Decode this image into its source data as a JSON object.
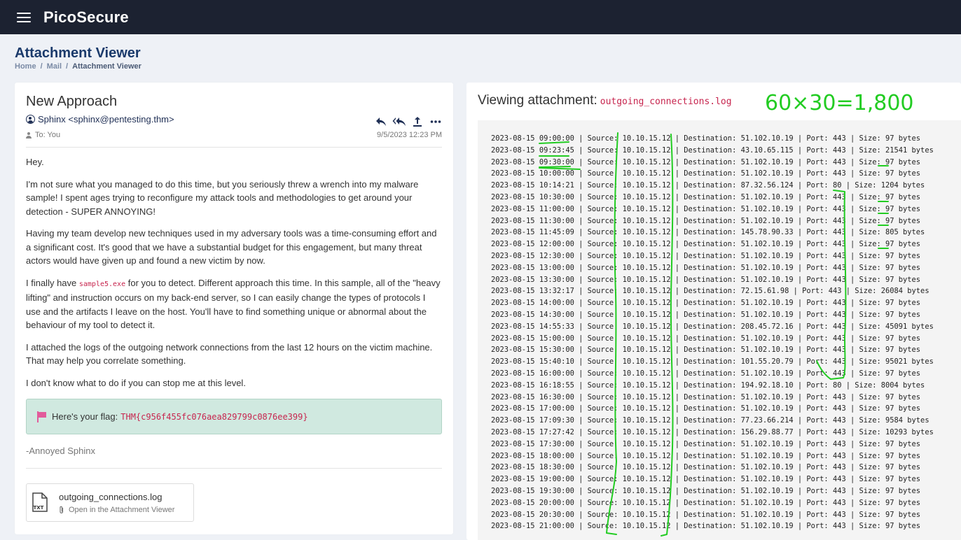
{
  "app": {
    "brand": "PicoSecure"
  },
  "page": {
    "title": "Attachment Viewer",
    "breadcrumb": [
      "Home",
      "Mail",
      "Attachment Viewer"
    ]
  },
  "email": {
    "subject": "New Approach",
    "from": "Sphinx <sphinx@pentesting.thm>",
    "to": "To: You",
    "date": "9/5/2023 12:23 PM",
    "body": {
      "p1": "Hey.",
      "p2": "I'm not sure what you managed to do this time, but you seriously threw a wrench into my malware sample! I spent ages trying to reconfigure my attack tools and methodologies to get around your detection - SUPER ANNOYING!",
      "p3": "Having my team develop new techniques used in my adversary tools was a time-consuming effort and a significant cost. It's good that we have a substantial budget for this engagement, but many threat actors would have given up and found a new victim by now.",
      "p4_pre": "I finally have ",
      "p4_code": "sample5.exe",
      "p4_post": " for you to detect. Different approach this time. In this sample, all of the \"heavy lifting\" and instruction occurs on my back-end server, so I can easily change the types of protocols I use and the artifacts I leave on the host. You'll have to find something unique or abnormal about the behaviour of my tool to detect it.",
      "p5": "I attached the logs of the outgoing network connections from the last 12 hours on the victim machine. That may help you correlate something.",
      "p6": "I don't know what to do if you can stop me at this level."
    },
    "flag_label": "Here's your flag:",
    "flag_value": "THM{c956f455fc076aea829799c0876ee399}",
    "signoff": "-Annoyed Sphinx",
    "attachment": {
      "name": "outgoing_connections.log",
      "type_label": "TXT",
      "action": "Open in the Attachment Viewer"
    }
  },
  "viewer": {
    "title_prefix": "Viewing attachment:",
    "filename": "outgoing_connections.log",
    "annotation": "60×30=1,800",
    "lines": [
      "2023-08-15 09:00:00 | Source: 10.10.15.12 | Destination: 51.102.10.19 | Port: 443 | Size: 97 bytes",
      "2023-08-15 09:23:45 | Source: 10.10.15.12 | Destination: 43.10.65.115 | Port: 443 | Size: 21541 bytes",
      "2023-08-15 09:30:00 | Source: 10.10.15.12 | Destination: 51.102.10.19 | Port: 443 | Size: 97 bytes",
      "2023-08-15 10:00:00 | Source: 10.10.15.12 | Destination: 51.102.10.19 | Port: 443 | Size: 97 bytes",
      "2023-08-15 10:14:21 | Source: 10.10.15.12 | Destination: 87.32.56.124 | Port: 80 | Size: 1204 bytes",
      "2023-08-15 10:30:00 | Source: 10.10.15.12 | Destination: 51.102.10.19 | Port: 443 | Size: 97 bytes",
      "2023-08-15 11:00:00 | Source: 10.10.15.12 | Destination: 51.102.10.19 | Port: 443 | Size: 97 bytes",
      "2023-08-15 11:30:00 | Source: 10.10.15.12 | Destination: 51.102.10.19 | Port: 443 | Size: 97 bytes",
      "2023-08-15 11:45:09 | Source: 10.10.15.12 | Destination: 145.78.90.33 | Port: 443 | Size: 805 bytes",
      "2023-08-15 12:00:00 | Source: 10.10.15.12 | Destination: 51.102.10.19 | Port: 443 | Size: 97 bytes",
      "2023-08-15 12:30:00 | Source: 10.10.15.12 | Destination: 51.102.10.19 | Port: 443 | Size: 97 bytes",
      "2023-08-15 13:00:00 | Source: 10.10.15.12 | Destination: 51.102.10.19 | Port: 443 | Size: 97 bytes",
      "2023-08-15 13:30:00 | Source: 10.10.15.12 | Destination: 51.102.10.19 | Port: 443 | Size: 97 bytes",
      "2023-08-15 13:32:17 | Source: 10.10.15.12 | Destination: 72.15.61.98 | Port: 443 | Size: 26084 bytes",
      "2023-08-15 14:00:00 | Source: 10.10.15.12 | Destination: 51.102.10.19 | Port: 443 | Size: 97 bytes",
      "2023-08-15 14:30:00 | Source: 10.10.15.12 | Destination: 51.102.10.19 | Port: 443 | Size: 97 bytes",
      "2023-08-15 14:55:33 | Source: 10.10.15.12 | Destination: 208.45.72.16 | Port: 443 | Size: 45091 bytes",
      "2023-08-15 15:00:00 | Source: 10.10.15.12 | Destination: 51.102.10.19 | Port: 443 | Size: 97 bytes",
      "2023-08-15 15:30:00 | Source: 10.10.15.12 | Destination: 51.102.10.19 | Port: 443 | Size: 97 bytes",
      "2023-08-15 15:40:10 | Source: 10.10.15.12 | Destination: 101.55.20.79 | Port: 443 | Size: 95021 bytes",
      "2023-08-15 16:00:00 | Source: 10.10.15.12 | Destination: 51.102.10.19 | Port: 443 | Size: 97 bytes",
      "2023-08-15 16:18:55 | Source: 10.10.15.12 | Destination: 194.92.18.10 | Port: 80 | Size: 8004 bytes",
      "2023-08-15 16:30:00 | Source: 10.10.15.12 | Destination: 51.102.10.19 | Port: 443 | Size: 97 bytes",
      "2023-08-15 17:00:00 | Source: 10.10.15.12 | Destination: 51.102.10.19 | Port: 443 | Size: 97 bytes",
      "2023-08-15 17:09:30 | Source: 10.10.15.12 | Destination: 77.23.66.214 | Port: 443 | Size: 9584 bytes",
      "2023-08-15 17:27:42 | Source: 10.10.15.12 | Destination: 156.29.88.77 | Port: 443 | Size: 10293 bytes",
      "2023-08-15 17:30:00 | Source: 10.10.15.12 | Destination: 51.102.10.19 | Port: 443 | Size: 97 bytes",
      "2023-08-15 18:00:00 | Source: 10.10.15.12 | Destination: 51.102.10.19 | Port: 443 | Size: 97 bytes",
      "2023-08-15 18:30:00 | Source: 10.10.15.12 | Destination: 51.102.10.19 | Port: 443 | Size: 97 bytes",
      "2023-08-15 19:00:00 | Source: 10.10.15.12 | Destination: 51.102.10.19 | Port: 443 | Size: 97 bytes",
      "2023-08-15 19:30:00 | Source: 10.10.15.12 | Destination: 51.102.10.19 | Port: 443 | Size: 97 bytes",
      "2023-08-15 20:00:00 | Source: 10.10.15.12 | Destination: 51.102.10.19 | Port: 443 | Size: 97 bytes",
      "2023-08-15 20:30:00 | Source: 10.10.15.12 | Destination: 51.102.10.19 | Port: 443 | Size: 97 bytes",
      "2023-08-15 21:00:00 | Source: 10.10.15.12 | Destination: 51.102.10.19 | Port: 443 | Size: 97 bytes"
    ]
  },
  "icons": {
    "menu": "hamburger-menu-icon",
    "user": "user-circle-icon",
    "reply": "reply-icon",
    "reply_all": "reply-all-icon",
    "forward": "share-upload-icon",
    "more": "more-dots-icon",
    "flag": "flag-icon",
    "file": "txt-file-icon",
    "clip": "paperclip-icon"
  },
  "colors": {
    "topbar": "#1c2231",
    "title": "#1a3a6b",
    "code": "#c7254e",
    "flag_bg": "#d0e9e0",
    "flag_icon": "#e25b9b",
    "annotation": "#22cc22"
  }
}
